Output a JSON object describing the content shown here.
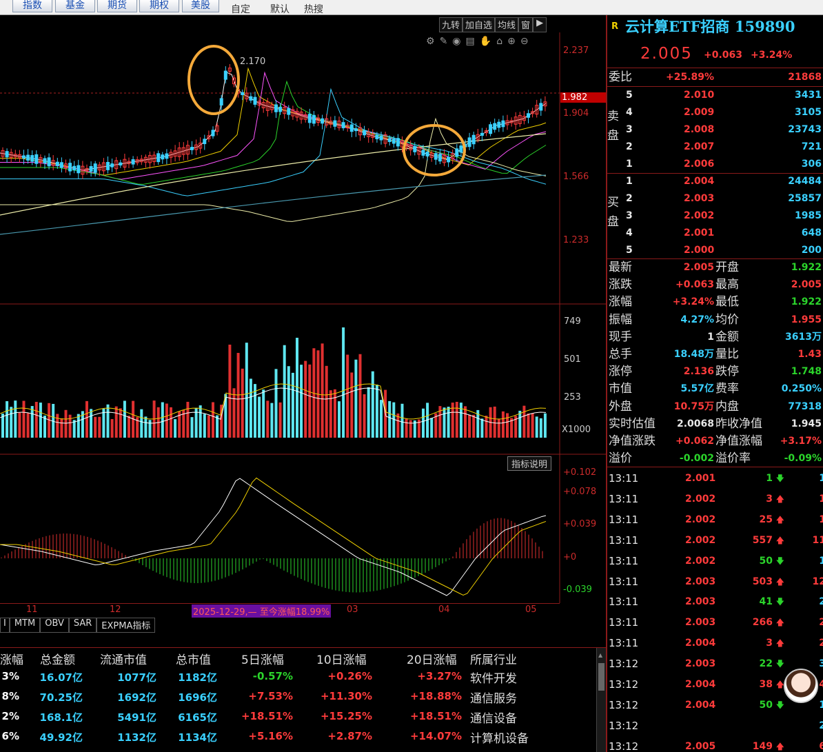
{
  "top_tabs": [
    "指数",
    "基金",
    "期货",
    "期权",
    "美股"
  ],
  "plain_tabs": [
    "自定",
    "默认",
    "热搜"
  ],
  "chart_toolbar": [
    "九转",
    "加自选",
    "均线",
    "窗"
  ],
  "security": {
    "badge": "R",
    "name": "云计算ETF招商 159890",
    "price": "2.005",
    "change": "+0.063",
    "change_pct": "+3.24%"
  },
  "price_axis": [
    "2.237",
    "1.982",
    "1.904",
    "1.566",
    "1.233"
  ],
  "peak_label": "2.170",
  "volume_axis": [
    "749",
    "501",
    "253",
    "X1000"
  ],
  "macd_axis": [
    "+0.102",
    "+0.078",
    "+0.039",
    "+0",
    "-0.039"
  ],
  "indicator_button": "指标说明",
  "date_ticks": [
    "11",
    "12",
    "03",
    "04",
    "05"
  ],
  "range_label": "2025-12-29,— 至今涨幅18.99%",
  "indicator_tabs": [
    "I",
    "MTM",
    "OBV",
    "SAR",
    "EXPMA指标"
  ],
  "order_ratio": {
    "label": "委比",
    "pct": "+25.89%",
    "vol": "21868"
  },
  "sell_orders": [
    {
      "lv": "5",
      "price": "2.010",
      "vol": "3431"
    },
    {
      "lv": "4",
      "price": "2.009",
      "vol": "3105"
    },
    {
      "lv": "3",
      "price": "2.008",
      "vol": "23743"
    },
    {
      "lv": "2",
      "price": "2.007",
      "vol": "721"
    },
    {
      "lv": "1",
      "price": "2.006",
      "vol": "306"
    }
  ],
  "sell_label": [
    "卖",
    "盘"
  ],
  "buy_orders": [
    {
      "lv": "1",
      "price": "2.004",
      "vol": "24484"
    },
    {
      "lv": "2",
      "price": "2.003",
      "vol": "25857"
    },
    {
      "lv": "3",
      "price": "2.002",
      "vol": "1985"
    },
    {
      "lv": "4",
      "price": "2.001",
      "vol": "648"
    },
    {
      "lv": "5",
      "price": "2.000",
      "vol": "200"
    }
  ],
  "buy_label": [
    "买",
    "盘"
  ],
  "stats": [
    {
      "l1": "最新",
      "v1": "2.005",
      "c1": "red",
      "l2": "开盘",
      "v2": "1.922",
      "c2": "grn"
    },
    {
      "l1": "涨跌",
      "v1": "+0.063",
      "c1": "red",
      "l2": "最高",
      "v2": "2.005",
      "c2": "red"
    },
    {
      "l1": "涨幅",
      "v1": "+3.24%",
      "c1": "red",
      "l2": "最低",
      "v2": "1.922",
      "c2": "grn"
    },
    {
      "l1": "振幅",
      "v1": "4.27%",
      "c1": "cyn",
      "l2": "均价",
      "v2": "1.955",
      "c2": "red"
    },
    {
      "l1": "现手",
      "v1": "1",
      "c1": "wht",
      "l2": "金额",
      "v2": "3613万",
      "c2": "cyn"
    },
    {
      "l1": "总手",
      "v1": "18.48万",
      "c1": "cyn",
      "l2": "量比",
      "v2": "1.43",
      "c2": "red"
    },
    {
      "l1": "涨停",
      "v1": "2.136",
      "c1": "red",
      "l2": "跌停",
      "v2": "1.748",
      "c2": "grn"
    },
    {
      "l1": "市值",
      "v1": "5.57亿",
      "c1": "cyn",
      "l2": "费率",
      "v2": "0.250%",
      "c2": "cyn"
    },
    {
      "l1": "外盘",
      "v1": "10.75万",
      "c1": "red",
      "l2": "内盘",
      "v2": "77318",
      "c2": "cyn"
    },
    {
      "l1": "实时估值",
      "v1": "2.0068",
      "c1": "wht",
      "l2": "昨收净值",
      "v2": "1.945",
      "c2": "wht"
    },
    {
      "l1": "净值涨跌",
      "v1": "+0.062",
      "c1": "red",
      "l2": "净值涨幅",
      "v2": "+3.17%",
      "c2": "red"
    },
    {
      "l1": "溢价",
      "v1": "-0.002",
      "c1": "grn",
      "l2": "溢价率",
      "v2": "-0.09%",
      "c2": "grn"
    }
  ],
  "ticks": [
    {
      "t": "13:11",
      "p": "2.001",
      "v": "1",
      "d": "dn",
      "n": "1"
    },
    {
      "t": "13:11",
      "p": "2.002",
      "v": "3",
      "d": "up",
      "n": "1"
    },
    {
      "t": "13:11",
      "p": "2.002",
      "v": "25",
      "d": "up",
      "n": "1"
    },
    {
      "t": "13:11",
      "p": "2.002",
      "v": "557",
      "d": "up",
      "n": "11"
    },
    {
      "t": "13:11",
      "p": "2.002",
      "v": "50",
      "d": "dn",
      "n": "1"
    },
    {
      "t": "13:11",
      "p": "2.003",
      "v": "503",
      "d": "up",
      "n": "12"
    },
    {
      "t": "13:11",
      "p": "2.003",
      "v": "41",
      "d": "dn",
      "n": "2"
    },
    {
      "t": "13:11",
      "p": "2.003",
      "v": "266",
      "d": "up",
      "n": "2"
    },
    {
      "t": "13:11",
      "p": "2.004",
      "v": "3",
      "d": "up",
      "n": "2"
    },
    {
      "t": "13:12",
      "p": "2.003",
      "v": "22",
      "d": "dn",
      "n": "3"
    },
    {
      "t": "13:12",
      "p": "2.004",
      "v": "38",
      "d": "up",
      "n": "4"
    },
    {
      "t": "13:12",
      "p": "2.004",
      "v": "50",
      "d": "dn",
      "n": "1"
    },
    {
      "t": "13:12",
      "p": "",
      "v": "",
      "d": "",
      "n": "2"
    },
    {
      "t": "13:12",
      "p": "2.005",
      "v": "149",
      "d": "up",
      "n": "6"
    }
  ],
  "table": {
    "headers": [
      "涨幅",
      "总金额",
      "流通市值",
      "总市值",
      "5日涨幅",
      "10日涨幅",
      "20日涨幅",
      "所属行业"
    ],
    "rows": [
      [
        "3%",
        "16.07亿",
        "1077亿",
        "1182亿",
        "-0.57%",
        "+0.26%",
        "+3.27%",
        "软件开发"
      ],
      [
        "8%",
        "70.25亿",
        "1692亿",
        "1696亿",
        "+7.53%",
        "+11.30%",
        "+18.88%",
        "通信服务"
      ],
      [
        "2%",
        "168.1亿",
        "5491亿",
        "6165亿",
        "+18.51%",
        "+15.25%",
        "+18.51%",
        "通信设备"
      ],
      [
        "6%",
        "49.92亿",
        "1132亿",
        "1134亿",
        "+5.16%",
        "+2.87%",
        "+14.07%",
        "计算机设备"
      ]
    ]
  },
  "colors": {
    "up": "#ff3b3b",
    "down": "#2bd42b",
    "cyan": "#3ad0ff",
    "frame": "#8b1a1a",
    "highlight_circle": "#f4a93a"
  }
}
